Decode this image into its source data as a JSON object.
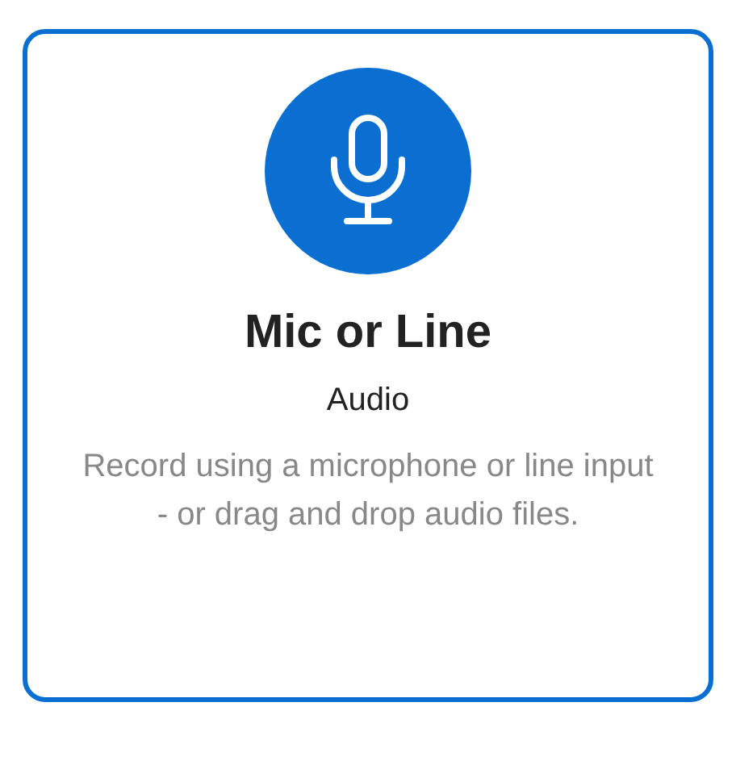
{
  "card": {
    "selected": true,
    "title": "Mic or Line",
    "subtitle": "Audio",
    "description": "Record using a microphone or line input - or drag and drop audio files."
  }
}
